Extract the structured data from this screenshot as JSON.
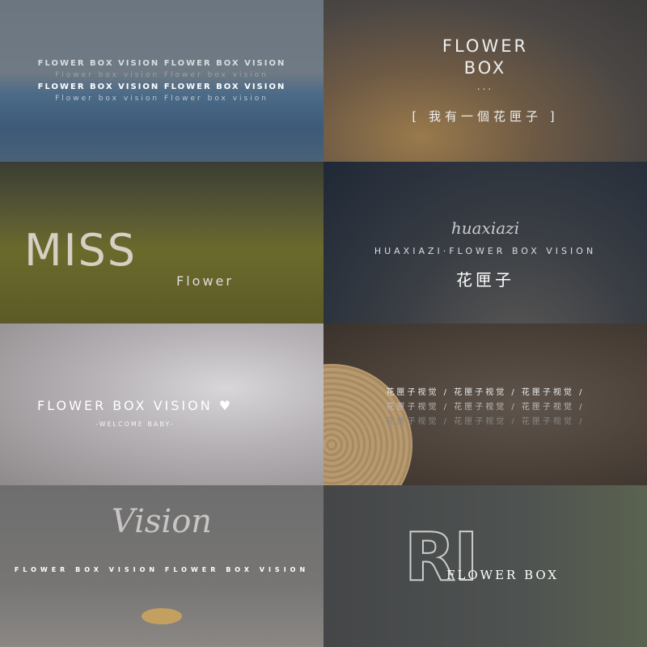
{
  "tiles": [
    {
      "lines": [
        "FLOWER BOX VISION  FLOWER BOX VISION",
        "Flower box vision  Flower box vision",
        "FLOWER BOX VISION  FLOWER BOX VISION",
        "Flower box vision  Flower box vision"
      ]
    },
    {
      "title1": "FLOWER",
      "title2": "BOX",
      "dots": "...",
      "subtitle": "[ 我有一個花匣子 ]"
    },
    {
      "logo": "MISS",
      "word": "Flower"
    },
    {
      "script": "huaxiazi",
      "line": "HUAXIAZI·FLOWER BOX VISION",
      "chinese": "花匣子"
    },
    {
      "title": "FLOWER BOX VISION",
      "heart": "♥",
      "subtitle": "-WELCOME BABY-"
    },
    {
      "rows": [
        "花匣子视觉 / 花匣子视觉 / 花匣子视觉 /",
        "花匣子视觉 / 花匣子视觉 / 花匣子视觉 /",
        "花匣子视觉 / 花匣子视觉 / 花匣子视觉 /"
      ]
    },
    {
      "script": "Vision",
      "line": "FLOWER BOX VISION FLOWER BOX VISION"
    },
    {
      "logo": "RI",
      "word": "FLOWER BOX"
    }
  ]
}
